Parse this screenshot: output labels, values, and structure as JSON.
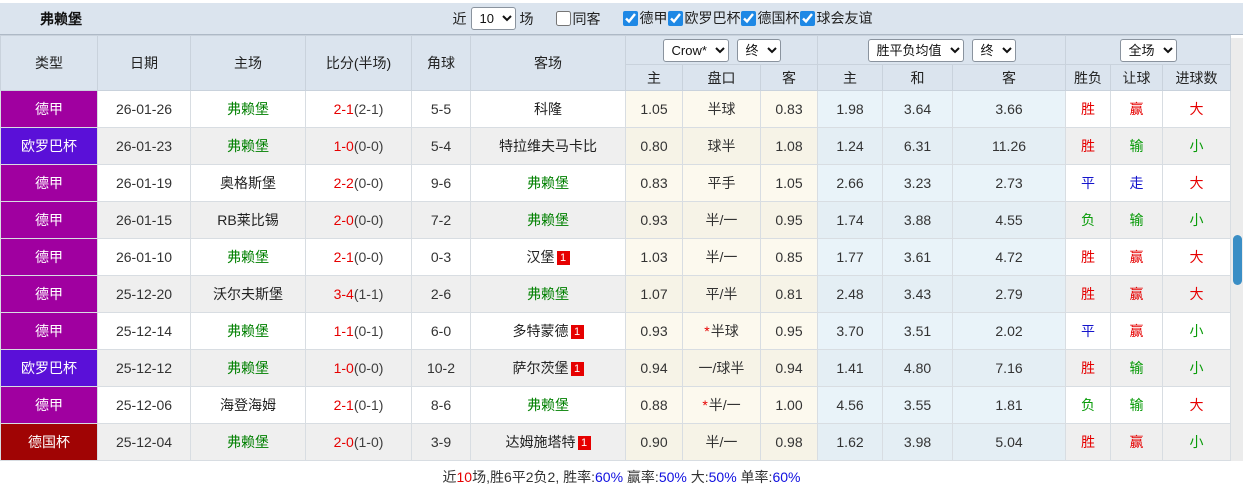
{
  "header": {
    "title": "弗赖堡",
    "filters": {
      "recent_label": "近",
      "recent_value": "10",
      "matches_label": "场",
      "same_venue": {
        "label": "同客",
        "checked": false
      },
      "competitions": [
        {
          "label": "德甲",
          "checked": true
        },
        {
          "label": "欧罗巴杯",
          "checked": true
        },
        {
          "label": "德国杯",
          "checked": true
        },
        {
          "label": "球会友谊",
          "checked": true
        }
      ]
    }
  },
  "table": {
    "selects": {
      "bookmaker": "Crow*",
      "bookmaker_state": "终",
      "avg_type": "胜平负均值",
      "avg_state": "终",
      "scope": "全场"
    },
    "columns": [
      "类型",
      "日期",
      "主场",
      "比分(半场)",
      "角球",
      "客场",
      "主",
      "盘口",
      "客",
      "主",
      "和",
      "客",
      "胜负",
      "让球",
      "进球数"
    ],
    "rows": [
      {
        "league": "德甲",
        "league_color": "#a000a0",
        "date": "26-01-26",
        "home": "弗赖堡",
        "focus": "home",
        "score": "2-1",
        "half": "(2-1)",
        "corners": "5-5",
        "away": "科隆",
        "away_badge": "",
        "home_odds": "1.05",
        "line": "半球",
        "star": false,
        "away_odds": "0.83",
        "avg_home": "1.98",
        "avg_draw": "3.64",
        "avg_away": "3.66",
        "wdl": "胜",
        "wdl_color": "red",
        "ah": "赢",
        "ah_color": "red",
        "ou": "大",
        "ou_color": "red"
      },
      {
        "league": "欧罗巴杯",
        "league_color": "#5a10d8",
        "date": "26-01-23",
        "home": "弗赖堡",
        "focus": "home",
        "score": "1-0",
        "half": "(0-0)",
        "corners": "5-4",
        "away": "特拉维夫马卡比",
        "away_badge": "",
        "home_odds": "0.80",
        "line": "球半",
        "star": false,
        "away_odds": "1.08",
        "avg_home": "1.24",
        "avg_draw": "6.31",
        "avg_away": "11.26",
        "wdl": "胜",
        "wdl_color": "red",
        "ah": "输",
        "ah_color": "green",
        "ou": "小",
        "ou_color": "green"
      },
      {
        "league": "德甲",
        "league_color": "#a000a0",
        "date": "26-01-19",
        "home": "奥格斯堡",
        "focus": "away",
        "score": "2-2",
        "half": "(0-0)",
        "corners": "9-6",
        "away": "弗赖堡",
        "away_badge": "",
        "home_odds": "0.83",
        "line": "平手",
        "star": false,
        "away_odds": "1.05",
        "avg_home": "2.66",
        "avg_draw": "3.23",
        "avg_away": "2.73",
        "wdl": "平",
        "wdl_color": "blue",
        "ah": "走",
        "ah_color": "blue",
        "ou": "大",
        "ou_color": "red"
      },
      {
        "league": "德甲",
        "league_color": "#a000a0",
        "date": "26-01-15",
        "home": "RB莱比锡",
        "focus": "away",
        "score": "2-0",
        "half": "(0-0)",
        "corners": "7-2",
        "away": "弗赖堡",
        "away_badge": "",
        "home_odds": "0.93",
        "line": "半/一",
        "star": false,
        "away_odds": "0.95",
        "avg_home": "1.74",
        "avg_draw": "3.88",
        "avg_away": "4.55",
        "wdl": "负",
        "wdl_color": "green",
        "ah": "输",
        "ah_color": "green",
        "ou": "小",
        "ou_color": "green"
      },
      {
        "league": "德甲",
        "league_color": "#a000a0",
        "date": "26-01-10",
        "home": "弗赖堡",
        "focus": "home",
        "score": "2-1",
        "half": "(0-0)",
        "corners": "0-3",
        "away": "汉堡",
        "away_badge": "1",
        "home_odds": "1.03",
        "line": "半/一",
        "star": false,
        "away_odds": "0.85",
        "avg_home": "1.77",
        "avg_draw": "3.61",
        "avg_away": "4.72",
        "wdl": "胜",
        "wdl_color": "red",
        "ah": "赢",
        "ah_color": "red",
        "ou": "大",
        "ou_color": "red"
      },
      {
        "league": "德甲",
        "league_color": "#a000a0",
        "date": "25-12-20",
        "home": "沃尔夫斯堡",
        "focus": "away",
        "score": "3-4",
        "half": "(1-1)",
        "corners": "2-6",
        "away": "弗赖堡",
        "away_badge": "",
        "home_odds": "1.07",
        "line": "平/半",
        "star": false,
        "away_odds": "0.81",
        "avg_home": "2.48",
        "avg_draw": "3.43",
        "avg_away": "2.79",
        "wdl": "胜",
        "wdl_color": "red",
        "ah": "赢",
        "ah_color": "red",
        "ou": "大",
        "ou_color": "red"
      },
      {
        "league": "德甲",
        "league_color": "#a000a0",
        "date": "25-12-14",
        "home": "弗赖堡",
        "focus": "home",
        "score": "1-1",
        "half": "(0-1)",
        "corners": "6-0",
        "away": "多特蒙德",
        "away_badge": "1",
        "home_odds": "0.93",
        "line": "半球",
        "star": true,
        "away_odds": "0.95",
        "avg_home": "3.70",
        "avg_draw": "3.51",
        "avg_away": "2.02",
        "wdl": "平",
        "wdl_color": "blue",
        "ah": "赢",
        "ah_color": "red",
        "ou": "小",
        "ou_color": "green"
      },
      {
        "league": "欧罗巴杯",
        "league_color": "#5a10d8",
        "date": "25-12-12",
        "home": "弗赖堡",
        "focus": "home",
        "score": "1-0",
        "half": "(0-0)",
        "corners": "10-2",
        "away": "萨尔茨堡",
        "away_badge": "1",
        "home_odds": "0.94",
        "line": "一/球半",
        "star": false,
        "away_odds": "0.94",
        "avg_home": "1.41",
        "avg_draw": "4.80",
        "avg_away": "7.16",
        "wdl": "胜",
        "wdl_color": "red",
        "ah": "输",
        "ah_color": "green",
        "ou": "小",
        "ou_color": "green"
      },
      {
        "league": "德甲",
        "league_color": "#a000a0",
        "date": "25-12-06",
        "home": "海登海姆",
        "focus": "away",
        "score": "2-1",
        "half": "(0-1)",
        "corners": "8-6",
        "away": "弗赖堡",
        "away_badge": "",
        "home_odds": "0.88",
        "line": "半/一",
        "star": true,
        "away_odds": "1.00",
        "avg_home": "4.56",
        "avg_draw": "3.55",
        "avg_away": "1.81",
        "wdl": "负",
        "wdl_color": "green",
        "ah": "输",
        "ah_color": "green",
        "ou": "大",
        "ou_color": "red"
      },
      {
        "league": "德国杯",
        "league_color": "#a00404",
        "date": "25-12-04",
        "home": "弗赖堡",
        "focus": "home",
        "score": "2-0",
        "half": "(1-0)",
        "corners": "3-9",
        "away": "达姆施塔特",
        "away_badge": "1",
        "home_odds": "0.90",
        "line": "半/一",
        "star": false,
        "away_odds": "0.98",
        "avg_home": "1.62",
        "avg_draw": "3.98",
        "avg_away": "5.04",
        "wdl": "胜",
        "wdl_color": "red",
        "ah": "赢",
        "ah_color": "red",
        "ou": "小",
        "ou_color": "green"
      }
    ]
  },
  "footer": {
    "segments": [
      {
        "text": "近",
        "color": "#333333"
      },
      {
        "text": "10",
        "color": "#e60000"
      },
      {
        "text": "场,胜6平2负2, 胜率:",
        "color": "#333333"
      },
      {
        "text": "60%",
        "color": "#1010e0"
      },
      {
        "text": " 赢率:",
        "color": "#333333"
      },
      {
        "text": "50%",
        "color": "#1010e0"
      },
      {
        "text": " 大:",
        "color": "#333333"
      },
      {
        "text": "50%",
        "color": "#1010e0"
      },
      {
        "text": " 单率:",
        "color": "#333333"
      },
      {
        "text": "60%",
        "color": "#1010e0"
      }
    ]
  },
  "colors": {
    "bundesliga": "#a000a0",
    "europa_league": "#5a10d8",
    "dfb_pokal": "#a00404",
    "focus_team_green": "#008000",
    "score_red": "#e60000",
    "result_red": "#e60000",
    "result_blue": "#1414cc",
    "result_green": "#089b08",
    "header_bg": "#dbe4ee",
    "alt_row_bg": "#efefef",
    "handicap_col_bg": "#fcf9ee",
    "avg_col_bg": "#e9f3f9",
    "footer_blue": "#1010e0",
    "scrollbar_thumb": "#3a8ec5"
  }
}
